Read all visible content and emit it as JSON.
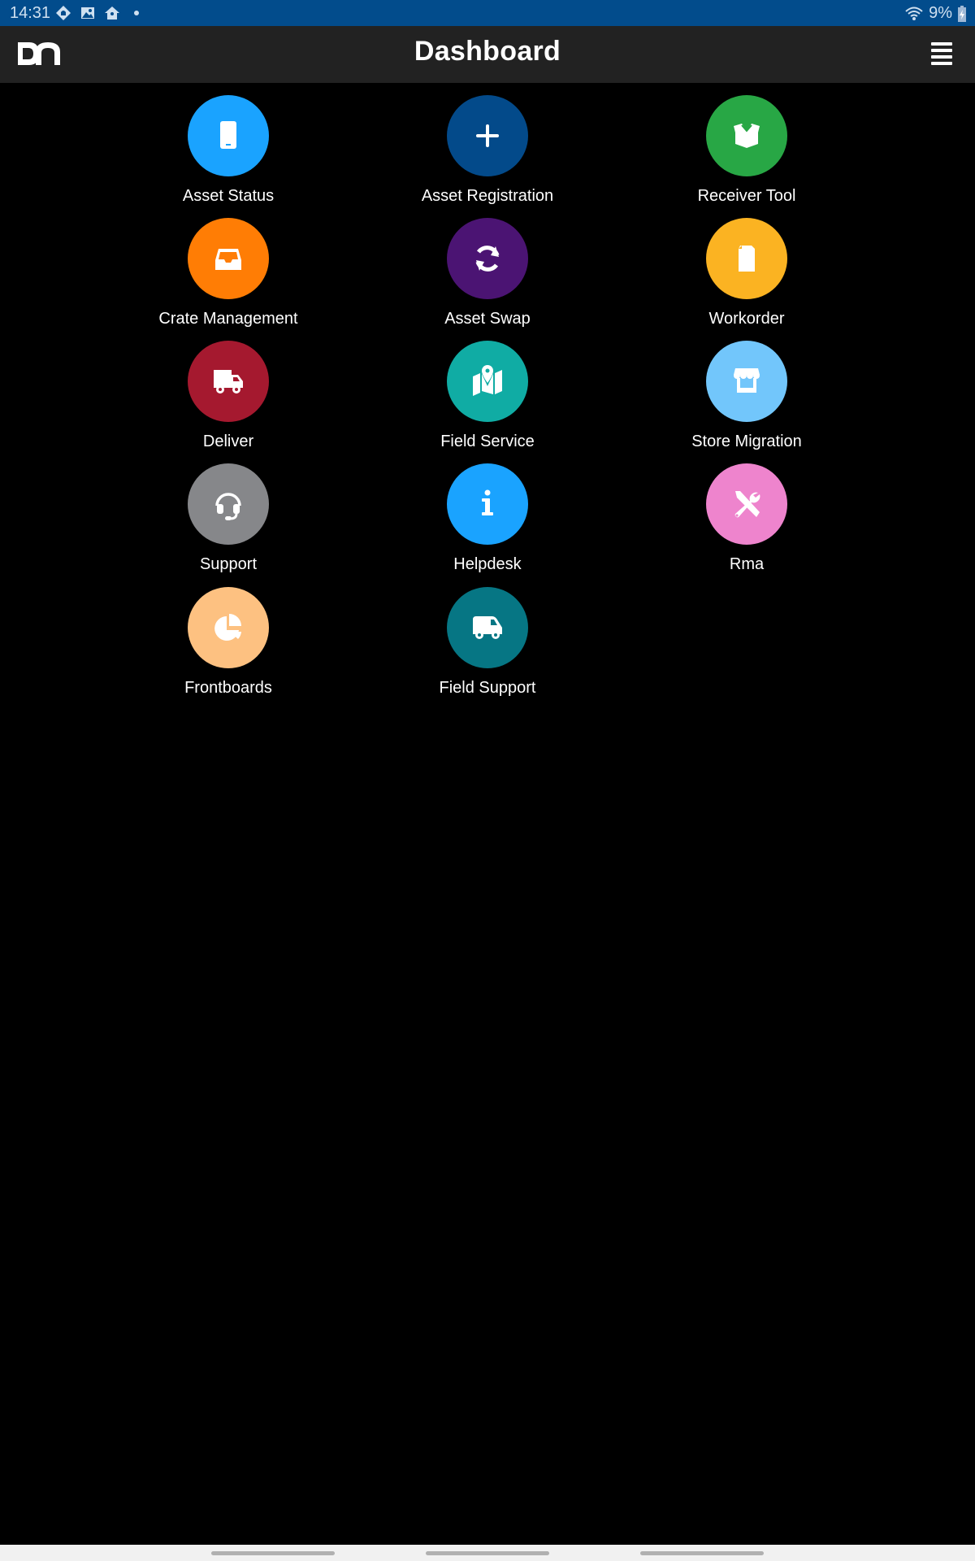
{
  "status_bar": {
    "time": "14:31",
    "notification_icons": [
      "vpn-icon",
      "image-icon",
      "home-assistant-icon",
      "dot-icon"
    ],
    "wifi_icon": "wifi-icon",
    "battery_percent": "9%",
    "battery_icon": "battery-charging-icon"
  },
  "header": {
    "logo": "DN",
    "title": "Dashboard",
    "menu_icon": "hamburger-menu-icon"
  },
  "tiles": [
    {
      "label": "Asset Status",
      "icon": "tablet-icon",
      "color": "#1aa3ff"
    },
    {
      "label": "Asset Registration",
      "icon": "plus-icon",
      "color": "#034a8a"
    },
    {
      "label": "Receiver Tool",
      "icon": "open-box-icon",
      "color": "#28a745"
    },
    {
      "label": "Crate Management",
      "icon": "inbox-tray-icon",
      "color": "#ff7d05"
    },
    {
      "label": "Asset Swap",
      "icon": "sync-icon",
      "color": "#4b1473"
    },
    {
      "label": "Workorder",
      "icon": "document-icon",
      "color": "#fbb322"
    },
    {
      "label": "Deliver",
      "icon": "truck-icon",
      "color": "#a5192f"
    },
    {
      "label": "Field Service",
      "icon": "map-pin-icon",
      "color": "#10aca4"
    },
    {
      "label": "Store Migration",
      "icon": "store-icon",
      "color": "#72c6fb"
    },
    {
      "label": "Support",
      "icon": "headset-icon",
      "color": "#86878a"
    },
    {
      "label": "Helpdesk",
      "icon": "info-icon",
      "color": "#1aa3ff"
    },
    {
      "label": "Rma",
      "icon": "tools-icon",
      "color": "#ee84cd"
    },
    {
      "label": "Frontboards",
      "icon": "pie-chart-icon",
      "color": "#fdc181"
    },
    {
      "label": "Field Support",
      "icon": "van-icon",
      "color": "#067684"
    }
  ],
  "nav_bar": {
    "buttons": [
      "recent-apps",
      "home",
      "back"
    ]
  }
}
